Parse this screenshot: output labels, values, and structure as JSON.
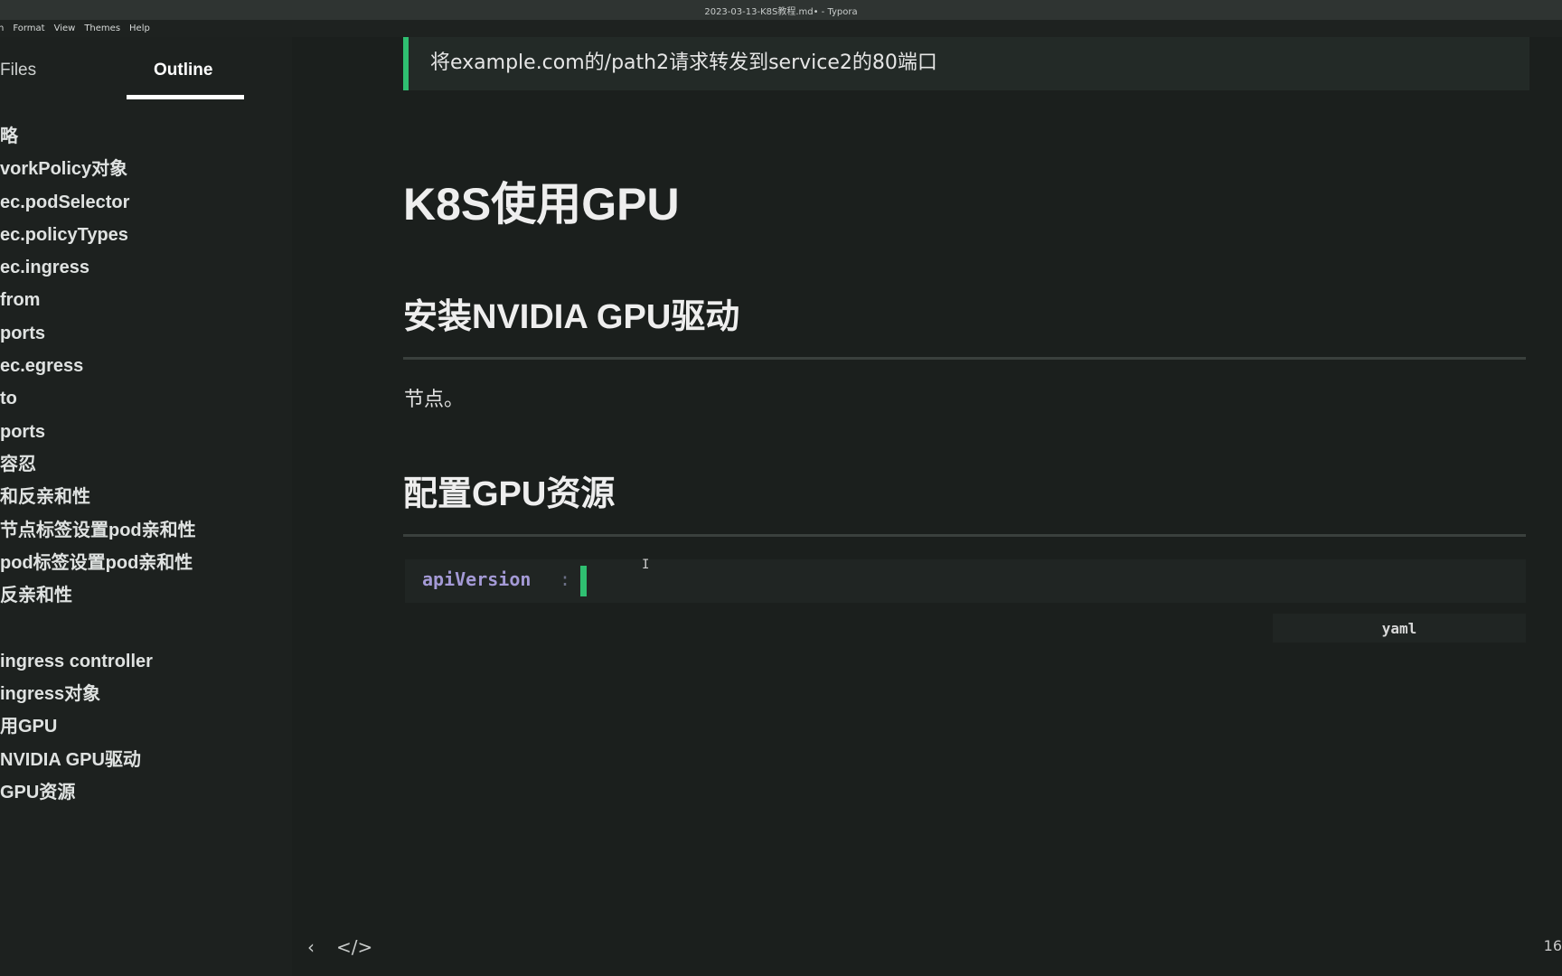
{
  "window": {
    "title": "2023-03-13-K8S教程.md• - Typora"
  },
  "menu": [
    "h",
    "Format",
    "View",
    "Themes",
    "Help"
  ],
  "sidebar": {
    "tabs": {
      "files": "Files",
      "outline": "Outline"
    },
    "outline_items": [
      "略",
      "vorkPolicy对象",
      "ec.podSelector",
      "ec.policyTypes",
      "ec.ingress",
      "from",
      "ports",
      "ec.egress",
      "to",
      "ports",
      "容忍",
      "和反亲和性",
      "节点标签设置pod亲和性",
      "pod标签设置pod亲和性",
      "反亲和性",
      "",
      "ingress controller",
      "ingress对象",
      "用GPU",
      "NVIDIA GPU驱动",
      "GPU资源"
    ]
  },
  "editor": {
    "blockquote": "将example.com的/path2请求转发到service2的80端口",
    "h1": "K8S使用GPU",
    "h2_install": "安装NVIDIA GPU驱动",
    "paragraph": "节点。",
    "h2_config": "配置GPU资源",
    "code": {
      "key": "apiVersion",
      "colon": ":",
      "language": "yaml"
    }
  },
  "status": {
    "count": "16"
  },
  "icons": {
    "back": "chevron-left-icon",
    "source": "code-icon",
    "ibeam": "text-cursor-icon"
  },
  "colors": {
    "accent": "#2fbf71",
    "background": "#1b1f1d",
    "code_key": "#a49ad6"
  }
}
